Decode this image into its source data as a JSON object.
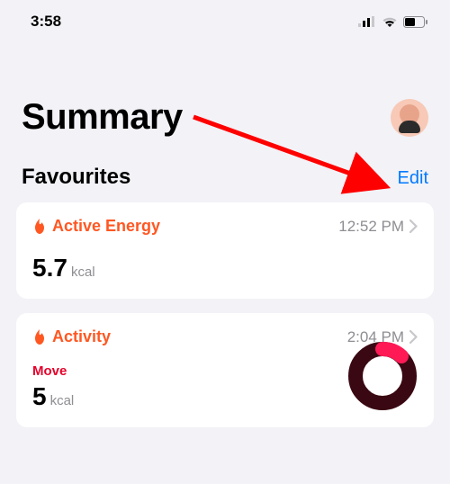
{
  "status": {
    "time": "3:58"
  },
  "header": {
    "title": "Summary"
  },
  "section": {
    "title": "Favourites",
    "edit": "Edit"
  },
  "cards": {
    "energy": {
      "name": "Active Energy",
      "time": "12:52 PM",
      "value": "5.7",
      "unit": "kcal"
    },
    "activity": {
      "name": "Activity",
      "time": "2:04 PM",
      "sub": "Move",
      "value": "5",
      "unit": "kcal"
    }
  }
}
